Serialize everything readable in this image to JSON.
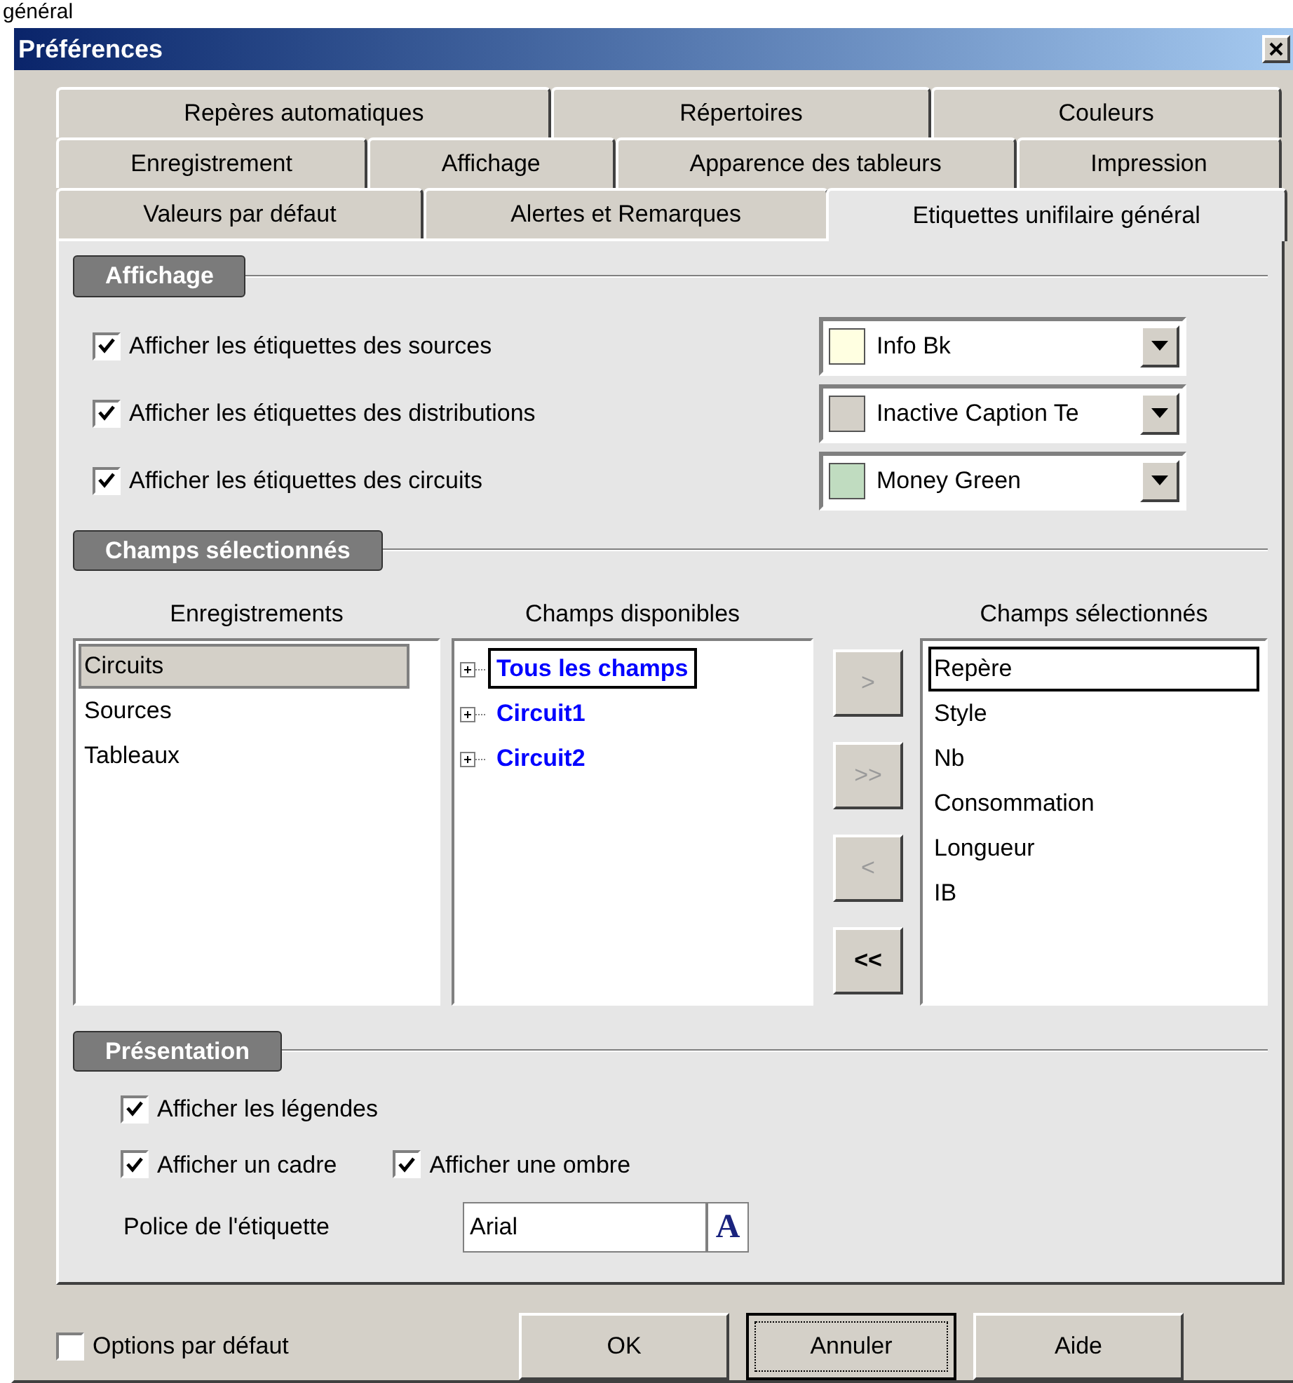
{
  "caption_fragment": "général",
  "window": {
    "title": "Préférences"
  },
  "tab_rows": [
    [
      {
        "label": "Repères automatiques",
        "selected": false
      },
      {
        "label": "Répertoires",
        "selected": false
      },
      {
        "label": "Couleurs",
        "selected": false
      }
    ],
    [
      {
        "label": "Enregistrement",
        "selected": false
      },
      {
        "label": "Affichage",
        "selected": false
      },
      {
        "label": "Apparence des tableurs",
        "selected": false
      },
      {
        "label": "Impression",
        "selected": false
      }
    ],
    [
      {
        "label": "Valeurs par défaut",
        "selected": false
      },
      {
        "label": "Alertes et Remarques",
        "selected": false
      },
      {
        "label": "Etiquettes unifilaire général",
        "selected": true
      }
    ]
  ],
  "affichage": {
    "title": "Affichage",
    "rows": [
      {
        "label": "Afficher les étiquettes des sources",
        "checked": true,
        "color_name": "Info Bk",
        "color": "#ffffe1"
      },
      {
        "label": "Afficher les étiquettes des distributions",
        "checked": true,
        "color_name": "Inactive Caption Te",
        "color": "#d4d0c8"
      },
      {
        "label": "Afficher les étiquettes des circuits",
        "checked": true,
        "color_name": "Money Green",
        "color": "#c0dcc0"
      }
    ]
  },
  "champs": {
    "title": "Champs sélectionnés",
    "enregistrements": {
      "heading": "Enregistrements",
      "items": [
        {
          "label": "Circuits",
          "selected": true
        },
        {
          "label": "Sources",
          "selected": false
        },
        {
          "label": "Tableaux",
          "selected": false
        }
      ]
    },
    "disponibles": {
      "heading": "Champs disponibles",
      "items": [
        {
          "label": "Tous les champs",
          "selected": true,
          "expanded": false
        },
        {
          "label": "Circuit1",
          "selected": false,
          "expanded": false
        },
        {
          "label": "Circuit2",
          "selected": false,
          "expanded": false
        }
      ]
    },
    "transfer_buttons": [
      {
        "label": ">",
        "disabled": true
      },
      {
        "label": ">>",
        "disabled": true
      },
      {
        "label": "<",
        "disabled": true
      },
      {
        "label": "<<",
        "disabled": false
      }
    ],
    "selectionnes": {
      "heading": "Champs sélectionnés",
      "items": [
        {
          "label": "Repère",
          "selected": true
        },
        {
          "label": "Style",
          "selected": false
        },
        {
          "label": "Nb",
          "selected": false
        },
        {
          "label": "Consommation",
          "selected": false
        },
        {
          "label": "Longueur",
          "selected": false
        },
        {
          "label": "IB",
          "selected": false
        }
      ]
    }
  },
  "presentation": {
    "title": "Présentation",
    "checkboxes": [
      {
        "label": "Afficher les légendes",
        "checked": true
      },
      {
        "label": "Afficher un cadre",
        "checked": true
      },
      {
        "label": "Afficher une ombre",
        "checked": true
      }
    ],
    "font_label": "Police de l'étiquette",
    "font_value": "Arial",
    "font_button": "A"
  },
  "default_options": {
    "label": "Options par défaut",
    "checked": false
  },
  "buttons": [
    {
      "label": "OK",
      "default": false
    },
    {
      "label": "Annuler",
      "default": true
    },
    {
      "label": "Aide",
      "default": false
    }
  ]
}
